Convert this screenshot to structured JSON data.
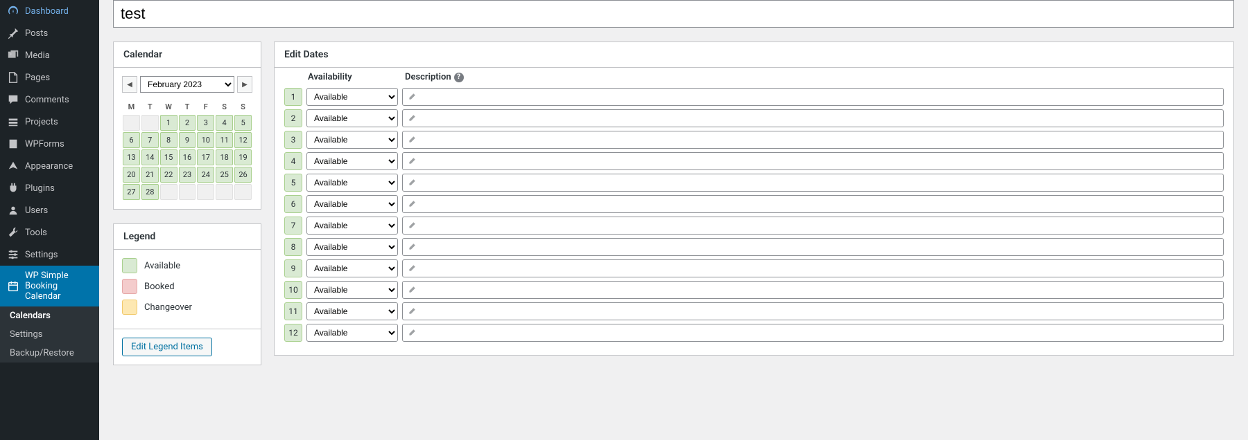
{
  "title_input": "test",
  "sidebar": {
    "items": [
      {
        "label": "Dashboard",
        "icon": "dashboard"
      },
      {
        "label": "Posts",
        "icon": "pin"
      },
      {
        "label": "Media",
        "icon": "media"
      },
      {
        "label": "Pages",
        "icon": "pages"
      },
      {
        "label": "Comments",
        "icon": "comments"
      },
      {
        "label": "Projects",
        "icon": "projects"
      },
      {
        "label": "WPForms",
        "icon": "forms"
      },
      {
        "label": "Appearance",
        "icon": "appearance"
      },
      {
        "label": "Plugins",
        "icon": "plugins"
      },
      {
        "label": "Users",
        "icon": "users"
      },
      {
        "label": "Tools",
        "icon": "tools"
      },
      {
        "label": "Settings",
        "icon": "settings"
      },
      {
        "label": "WP Simple Booking Calendar",
        "icon": "calendar"
      }
    ],
    "submenu": [
      {
        "label": "Calendars"
      },
      {
        "label": "Settings"
      },
      {
        "label": "Backup/Restore"
      }
    ]
  },
  "calendar": {
    "title": "Calendar",
    "month": "February 2023",
    "weekdays": [
      "M",
      "T",
      "W",
      "T",
      "F",
      "S",
      "S"
    ],
    "weeks": [
      [
        null,
        null,
        1,
        2,
        3,
        4,
        5
      ],
      [
        6,
        7,
        8,
        9,
        10,
        11,
        12
      ],
      [
        13,
        14,
        15,
        16,
        17,
        18,
        19
      ],
      [
        20,
        21,
        22,
        23,
        24,
        25,
        26
      ],
      [
        27,
        28,
        null,
        null,
        null,
        null,
        null
      ]
    ]
  },
  "legend": {
    "title": "Legend",
    "items": [
      {
        "label": "Available",
        "class": "sw-available"
      },
      {
        "label": "Booked",
        "class": "sw-booked"
      },
      {
        "label": "Changeover",
        "class": "sw-changeover"
      }
    ],
    "edit_button": "Edit Legend Items"
  },
  "edit_dates": {
    "title": "Edit Dates",
    "availability_header": "Availability",
    "description_header": "Description",
    "rows": [
      {
        "day": "1",
        "status": "Available"
      },
      {
        "day": "2",
        "status": "Available"
      },
      {
        "day": "3",
        "status": "Available"
      },
      {
        "day": "4",
        "status": "Available"
      },
      {
        "day": "5",
        "status": "Available"
      },
      {
        "day": "6",
        "status": "Available"
      },
      {
        "day": "7",
        "status": "Available"
      },
      {
        "day": "8",
        "status": "Available"
      },
      {
        "day": "9",
        "status": "Available"
      },
      {
        "day": "10",
        "status": "Available"
      },
      {
        "day": "11",
        "status": "Available"
      },
      {
        "day": "12",
        "status": "Available"
      }
    ]
  },
  "colors": {
    "available_bg": "#d9ead3",
    "available_border": "#a9d08e",
    "booked_bg": "#f4cccc",
    "changeover_bg": "#fde8b2",
    "wp_blue": "#0073aa"
  }
}
